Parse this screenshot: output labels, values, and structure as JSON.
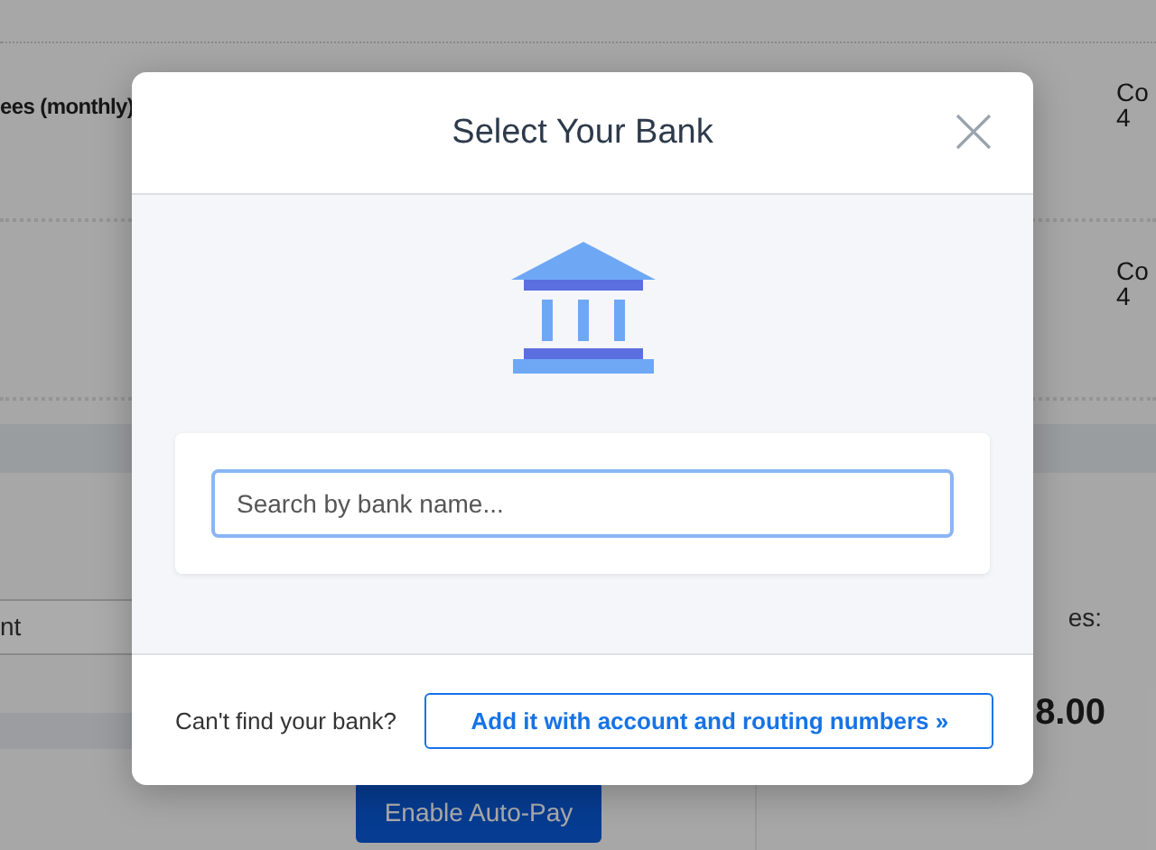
{
  "background": {
    "fee_label": "ees (monthly)",
    "rows": [
      {
        "line_1": "Co",
        "line_2": "4"
      },
      {
        "line_1": "Co",
        "line_2": "4"
      }
    ],
    "field_value": "nt",
    "summary_label": "es:",
    "summary_amount": "8.00",
    "button": "Enable Auto-Pay"
  },
  "dialog": {
    "title": "Select Your Bank",
    "search": {
      "placeholder": "Search by bank name..."
    },
    "footer": {
      "prompt": "Can't find your bank?",
      "link_button": "Add it with account and routing numbers »"
    }
  }
}
